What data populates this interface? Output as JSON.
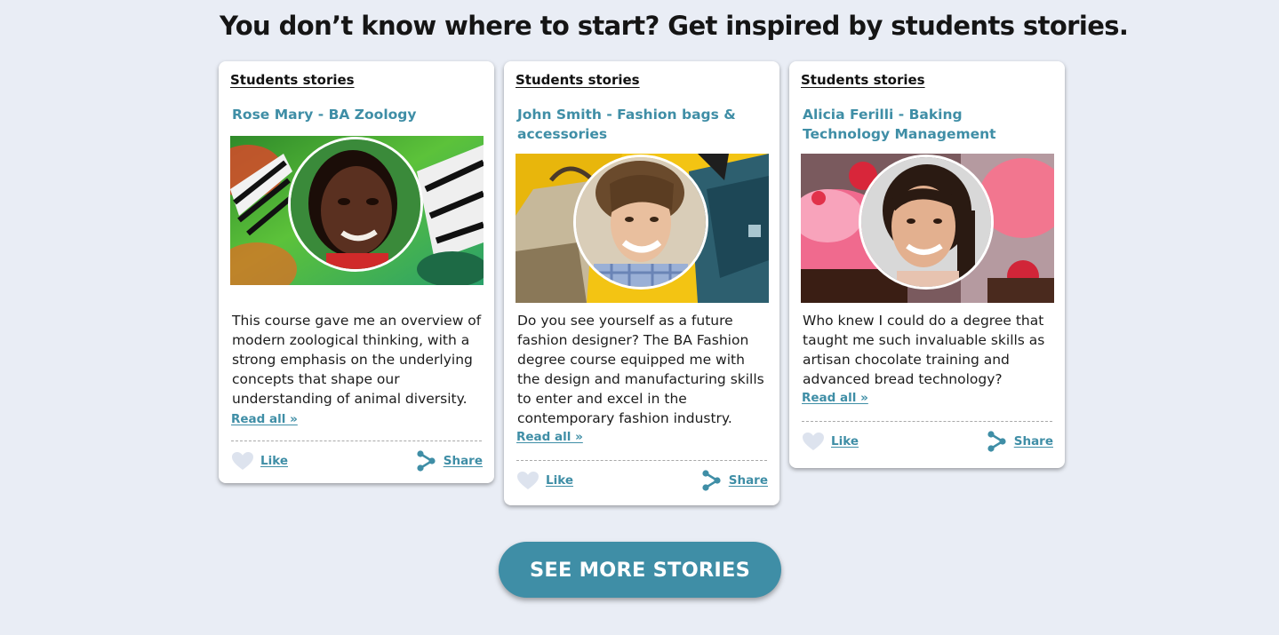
{
  "headline": "You don’t know where to start? Get inspired by students stories.",
  "accent_color": "#3f8ea6",
  "cards": [
    {
      "kicker": "Students stories",
      "title": "Rose Mary - BA Zoology",
      "body": "This course gave me an overview of modern zoological thinking, with a strong emphasis on the underlying concepts that shape our understanding of animal diversity.",
      "read_all": "Read all »",
      "like": "Like",
      "share": "Share",
      "photo_icon": "butterfly-photo"
    },
    {
      "kicker": "Students stories",
      "title": "John Smith - Fashion bags & accessories",
      "body": "Do you see yourself as a future fashion designer? The BA Fashion degree course equipped me with the design and manufacturing skills to enter and excel in the contemporary fashion industry.",
      "read_all": "Read all »",
      "like": "Like",
      "share": "Share",
      "photo_icon": "bags-photo"
    },
    {
      "kicker": "Students stories",
      "title": "Alicia Ferilli - Baking Technology Management",
      "body": "Who knew I could do a degree that taught me such invaluable skills as artisan chocolate training and advanced bread technology?",
      "read_all": "Read all »",
      "like": "Like",
      "share": "Share",
      "photo_icon": "cupcake-photo"
    }
  ],
  "cta": "SEE MORE STORIES"
}
